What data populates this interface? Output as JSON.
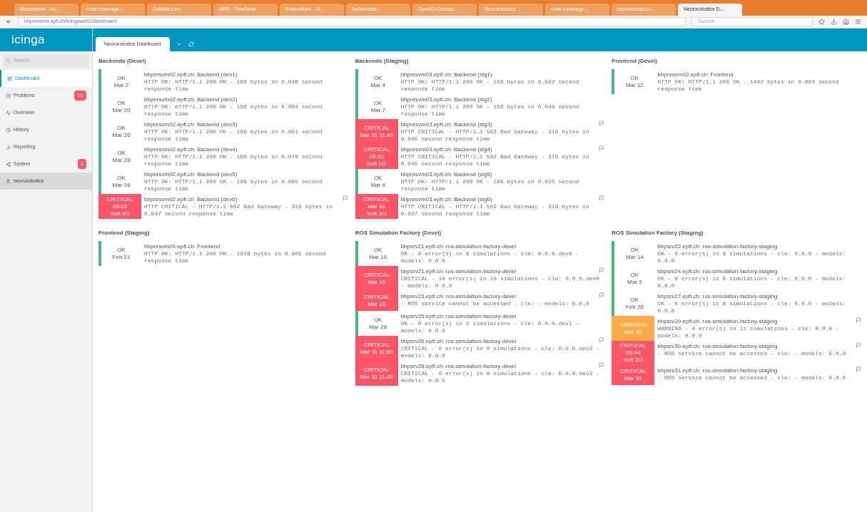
{
  "browser": {
    "tabs": [
      {
        "title": "Messagerie - Ac...",
        "selected": false
      },
      {
        "title": "code coverage -...",
        "selected": false
      },
      {
        "title": "Outlook.com",
        "selected": false
      },
      {
        "title": "MRP - OneDrive",
        "selected": false
      },
      {
        "title": "Evaluations - G...",
        "selected": false
      },
      {
        "title": "Deliverable...",
        "selected": false
      },
      {
        "title": "OpenCI Connec...",
        "selected": false
      },
      {
        "title": "Neurorobotics ...",
        "selected": false
      },
      {
        "title": "code coverage ...",
        "selected": false
      },
      {
        "title": "neurorobotics.i...",
        "selected": false
      },
      {
        "title": "Neurorobotics D...",
        "selected": true
      }
    ],
    "url": "bbpnrsvm4.epfl.ch/icingaweb2/dashboard",
    "search_placeholder": "Suchen"
  },
  "logo": "icinga",
  "search": {
    "placeholder": "Search ..."
  },
  "nav": [
    {
      "label": "Dashboard",
      "selected": true
    },
    {
      "label": "Problems",
      "selected": false,
      "badge": "10"
    },
    {
      "label": "Overview",
      "selected": false
    },
    {
      "label": "History",
      "selected": false
    },
    {
      "label": "Reporting",
      "selected": false
    },
    {
      "label": "System",
      "selected": false,
      "badge": "1"
    },
    {
      "label": "neurorobotics",
      "selected": false
    }
  ],
  "dashboard_tab": {
    "label": "Neurorobotics Dashboard",
    "selected": true
  },
  "dashlets": [
    {
      "title": "Backends (Devel)",
      "rows": [
        {
          "state": "OK",
          "kind": "ok",
          "since": "Mar 2",
          "service": "bbpnrsvm02.epfl.ch: Backend (dev1)",
          "output": "HTTP OK: HTTP/1.1 200 OK - 166 bytes in 0.046 second response time"
        },
        {
          "state": "OK",
          "kind": "ok",
          "since": "Mar 20",
          "service": "bbpnrsvm02.epfl.ch: Backend (dev2)",
          "output": "HTTP OK: HTTP/1.1 200 OK - 166 bytes in 0.084 second response time"
        },
        {
          "state": "OK",
          "kind": "ok",
          "since": "Mar 26",
          "service": "bbpnrsvm02.epfl.ch: Backend (dev3)",
          "output": "HTTP OK: HTTP/1.1 200 OK - 166 bytes in 0.051 second response time"
        },
        {
          "state": "OK",
          "kind": "ok",
          "since": "Mar 28",
          "service": "bbpnrsvm02.epfl.ch: Backend (dev4)",
          "output": "HTTP OK: HTTP/1.1 200 OK - 166 bytes in 0.078 second response time"
        },
        {
          "state": "OK",
          "kind": "ok",
          "since": "Mar 28",
          "service": "bbpnrsvm02.epfl.ch: Backend (dev5)",
          "output": "HTTP OK: HTTP/1.1 200 OK - 166 bytes in 0.065 second response time"
        },
        {
          "state": "CRITICAL",
          "kind": "critical",
          "since": "09:20",
          "since2": "Soft 2/3",
          "service": "bbpnrsvm02.epfl.ch: Backend (dev6)",
          "output": "HTTP CRITICAL - HTTP/1.1 502 Bad Gateway - 316 bytes in 0.047 second response time",
          "flag": true
        }
      ]
    },
    {
      "title": "Backends (Staging)",
      "rows": [
        {
          "state": "OK",
          "kind": "ok",
          "since": "Mar 4",
          "service": "bbpnrsvm03.epfl.ch: Backend (stg1)",
          "output": "HTTP OK: HTTP/1.1 200 OK - 166 bytes in 0.022 second response time"
        },
        {
          "state": "OK",
          "kind": "ok",
          "since": "Mar 7",
          "service": "bbpnrsvm03.epfl.ch: Backend (stg2)",
          "output": "HTTP OK: HTTP/1.1 200 OK - 166 bytes in 0.048 second response time"
        },
        {
          "state": "CRITICAL",
          "kind": "critical",
          "since": "Mar 31 11:49",
          "service": "bbpnrsvm03.epfl.ch: Backend (stg3)",
          "output": "HTTP CRITICAL - HTTP/1.1 502 Bad Gateway - 316 bytes in 0.045 second response time",
          "flag": true
        },
        {
          "state": "CRITICAL",
          "kind": "critical",
          "since": "09:42",
          "since2": "Soft 1/3",
          "service": "bbpnrsvm03.epfl.ch: Backend (stg4)",
          "output": "HTTP CRITICAL - HTTP/1.1 502 Bad Gateway - 316 bytes in 0.045 second response time",
          "flag": true
        },
        {
          "state": "OK",
          "kind": "ok",
          "since": "Mar 4",
          "service": "bbpnrsvm03.epfl.ch: Backend (stg5)",
          "output": "HTTP OK: HTTP/1.1 200 OK - 166 bytes in 0.025 second response time"
        },
        {
          "state": "CRITICAL",
          "kind": "critical",
          "since": "Mar 31",
          "since2": "Soft 2/3",
          "service": "bbpnrsvm03.epfl.ch: Backend (stg6)",
          "output": "HTTP CRITICAL - HTTP/1.1 502 Bad Gateway - 316 bytes in 0.027 second response time",
          "flag": true
        }
      ]
    },
    {
      "title": "Frontend (Devel)",
      "rows": [
        {
          "state": "OK",
          "kind": "ok",
          "since": "Mar 12",
          "service": "bbpnrsvm02.epfl.ch: Frontend",
          "output": "HTTP OK: HTTP/1.1 200 OK - 1442 bytes in 0.004 second response time"
        }
      ]
    },
    {
      "title": "Frontend (Staging)",
      "rows": [
        {
          "state": "OK",
          "kind": "ok",
          "since": "Feb 21",
          "service": "bbpnrsvm03.epfl.ch: Frontend",
          "output": "HTTP OK: HTTP/1.1 200 OK - 1019 bytes in 0.005 second response time"
        }
      ]
    },
    {
      "title": "ROS Simulation Factory (Devel)",
      "rows": [
        {
          "state": "OK",
          "kind": "ok",
          "since": "Mar 16",
          "service": "bbpsrv21.epfl.ch: ros-simulation-factory-devel",
          "output": "OK - 0 error(s) in 8 simulations - cle: 0.0.0.dev0 - models: 0.0.0"
        },
        {
          "state": "CRITICAL",
          "kind": "critical",
          "since": "Mar 16",
          "service": "bbpsrv21.epfl.ch: ros-simulation-factory-devel",
          "output": "CRITICAL - 10 error(s) in 10 simulations - cle: 0.0.0.dev0 - models: 0.0.0",
          "flag": true
        },
        {
          "state": "CRITICAL",
          "kind": "critical",
          "since": "Mar 16",
          "service": "bbpsrv23.epfl.ch: ros-simulation-factory-devel",
          "output": "- ROS service cannot be accessed - cle: - models: 0.0.0",
          "flag": true
        },
        {
          "state": "OK",
          "kind": "ok",
          "since": "Mar 28",
          "service": "bbpsrv25.epfl.ch: ros-simulation-factory-devel",
          "output": "OK - 0 error(s) in 2 simulations - cle: 0.0.0.dev1 - models: 0.0.0"
        },
        {
          "state": "CRITICAL",
          "kind": "critical",
          "since": "Mar 31 11:50",
          "service": "bbpsrv26.epfl.ch: ros-simulation-factory-devel",
          "output": "CRITICAL - 0 error(s) in 0 simulations - cle: 0.0.0.dev2 - models: 0.0.0",
          "flag": true
        },
        {
          "state": "CRITICAL",
          "kind": "critical",
          "since": "Mar 31 11:48",
          "service": "bbpsrv28.epfl.ch: ros-simulation-factory-devel",
          "output": "CRITICAL - 0 error(s) in 0 simulations - cle: 0.0.0.dev2 - models: 0.0.0",
          "flag": true
        }
      ]
    },
    {
      "title": "ROS Simulation Factory (Staging)",
      "rows": [
        {
          "state": "OK",
          "kind": "ok",
          "since": "Mar 14",
          "service": "bbpsrv22.epfl.ch: ros-simulation-factory-staging",
          "output": "OK - 0 error(s) in 8 simulations - cle: 0.0.0 - models: 0.0.0"
        },
        {
          "state": "OK",
          "kind": "ok",
          "since": "Mar 3",
          "service": "bbpsrv24.epfl.ch: ros-simulation-factory-staging",
          "output": "OK - 0 error(s) in 8 simulations - cle: 0.0.0 - models: 0.0.0"
        },
        {
          "state": "OK",
          "kind": "ok",
          "since": "Feb 28",
          "service": "bbpsrv27.epfl.ch: ros-simulation-factory-staging",
          "output": "OK - 0 error(s) in 8 simulations - cle: 0.0.0 - models: 0.0.0"
        },
        {
          "state": "WARNING",
          "kind": "warning",
          "since": "Mar 30",
          "service": "bbpsrv29.epfl.ch: ros-simulation-factory-staging",
          "output": "WARNING - 4 error(s) in 11 simulations - cle: 0.0.0 - models: 0.0.0",
          "flag": true
        },
        {
          "state": "CRITICAL",
          "kind": "critical",
          "since": "09:44",
          "since2": "Soft 2/3",
          "service": "bbpsrv30.epfl.ch: ros-simulation-factory-staging",
          "output": "- ROS service cannot be accessed - cle: - models: 0.0.0",
          "flag": true
        },
        {
          "state": "CRITICAL",
          "kind": "critical",
          "since": "Mar 31",
          "service": "bbpsrv31.epfl.ch: ros-simulation-factory-staging",
          "output": "- ROS service cannot be accessed - cle: - models: 0.0.0",
          "flag": true
        }
      ]
    }
  ]
}
